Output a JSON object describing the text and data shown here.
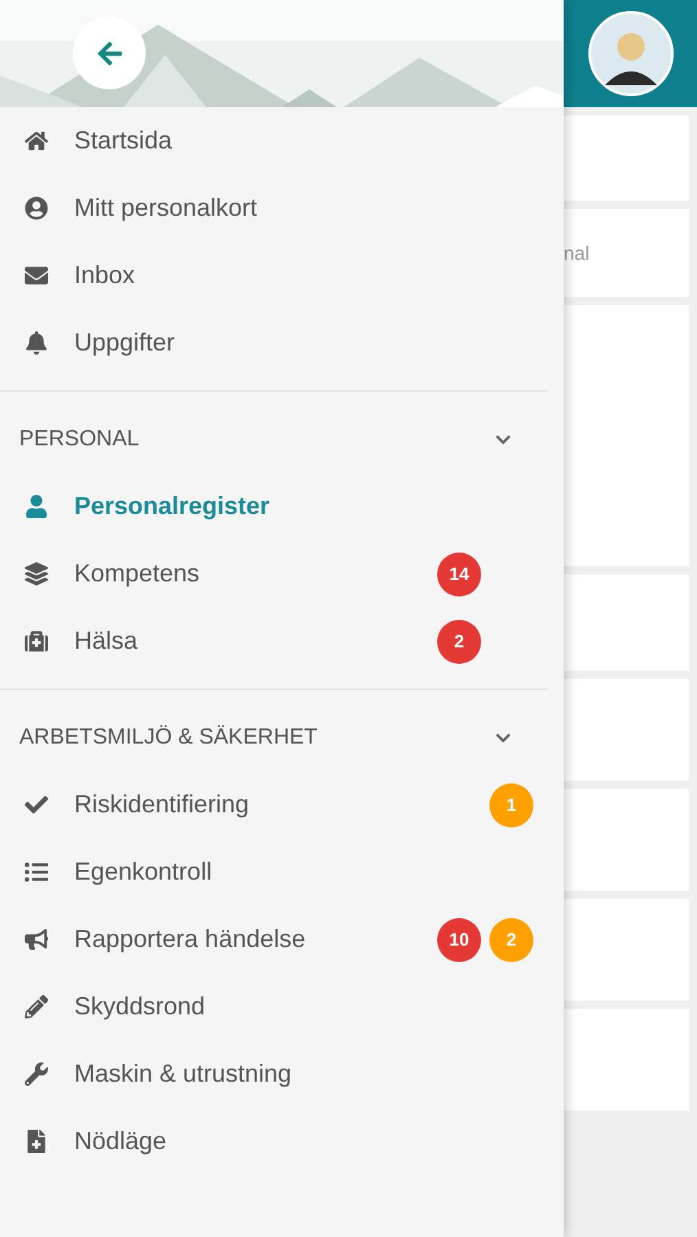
{
  "drawer": {
    "sections": [
      {
        "items": [
          {
            "label": "Startsida",
            "selected": false
          },
          {
            "label": "Mitt personalkort",
            "selected": false
          },
          {
            "label": "Inbox",
            "selected": false
          },
          {
            "label": "Uppgifter",
            "selected": false
          }
        ]
      },
      {
        "title": "PERSONAL",
        "expanded": true,
        "items": [
          {
            "label": "Personalregister",
            "selected": true
          },
          {
            "label": "Kompetens",
            "selected": false,
            "badges": [
              {
                "kind": "alert",
                "text": "14",
                "color": "#e53935"
              }
            ]
          },
          {
            "label": "Hälsa",
            "selected": false,
            "badges": [
              {
                "kind": "alert",
                "text": "2",
                "color": "#e53935"
              }
            ]
          }
        ]
      },
      {
        "title": "ARBETSMILJÖ & SÄKERHET",
        "expanded": true,
        "items": [
          {
            "label": "Riskidentifiering",
            "selected": false,
            "badges": [
              {
                "kind": "warning",
                "text": "1",
                "color": "#ffa000"
              }
            ]
          },
          {
            "label": "Egenkontroll",
            "selected": false
          },
          {
            "label": "Rapportera händelse",
            "selected": false,
            "badges": [
              {
                "kind": "alert",
                "text": "10",
                "color": "#e53935"
              },
              {
                "kind": "warning",
                "text": "2",
                "color": "#ffa000"
              }
            ]
          },
          {
            "label": "Skyddsrond",
            "selected": false
          },
          {
            "label": "Maskin & utrustning",
            "selected": false
          },
          {
            "label": "Nödläge",
            "selected": false
          }
        ]
      }
    ]
  },
  "background": {
    "card_text": "nal"
  }
}
